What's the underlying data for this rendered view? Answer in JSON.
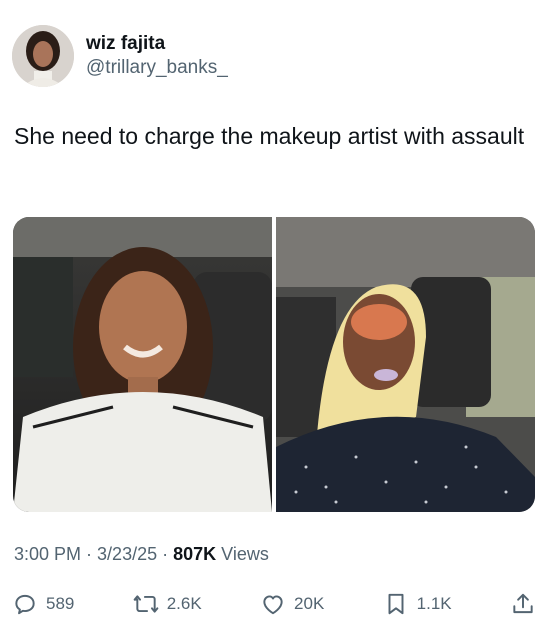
{
  "author": {
    "display_name": "wiz fajita",
    "handle": "@trillary_banks_",
    "avatar_icon": "profile-photo"
  },
  "tweet": {
    "text": "She need to charge the makeup artist with assault"
  },
  "media": {
    "photos": [
      {
        "description_icon": "selfie-photo-1"
      },
      {
        "description_icon": "selfie-photo-2"
      }
    ]
  },
  "meta": {
    "time": "3:00 PM",
    "separator": "·",
    "date": "3/23/25",
    "views_count": "807K",
    "views_label": "Views"
  },
  "actions": {
    "replies": "589",
    "reposts": "2.6K",
    "likes": "20K",
    "bookmarks": "1.1K"
  },
  "colors": {
    "primary_text": "#0f1419",
    "secondary_text": "#536471",
    "background": "#ffffff"
  }
}
